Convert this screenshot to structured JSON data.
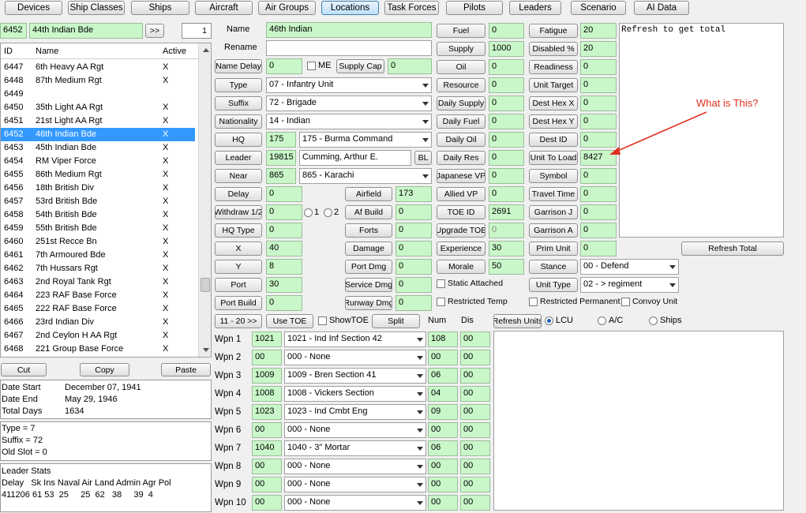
{
  "tabs": [
    "Devices",
    "Ship Classes",
    "Ships",
    "Aircraft",
    "Air Groups",
    "Locations",
    "Task Forces",
    "Pilots",
    "Leaders",
    "Scenario",
    "AI Data"
  ],
  "active_tab": "Locations",
  "nav": {
    "id": "6452",
    "name": "44th Indian Bde",
    "next": ">>",
    "page": "1"
  },
  "list": {
    "headers": {
      "id": "ID",
      "name": "Name",
      "active": "Active"
    },
    "rows": [
      {
        "id": "6447",
        "name": "6th Heavy AA Rgt",
        "active": "X"
      },
      {
        "id": "6448",
        "name": "87th Medium Rgt",
        "active": "X"
      },
      {
        "id": "6449",
        "name": "",
        "active": ""
      },
      {
        "id": "6450",
        "name": "35th Light AA Rgt",
        "active": "X"
      },
      {
        "id": "6451",
        "name": "21st Light AA Rgt",
        "active": "X"
      },
      {
        "id": "6452",
        "name": "46th Indian Bde",
        "active": "X"
      },
      {
        "id": "6453",
        "name": "45th Indian Bde",
        "active": "X"
      },
      {
        "id": "6454",
        "name": "RM Viper Force",
        "active": "X"
      },
      {
        "id": "6455",
        "name": "86th Medium Rgt",
        "active": "X"
      },
      {
        "id": "6456",
        "name": "18th British Div",
        "active": "X"
      },
      {
        "id": "6457",
        "name": "53rd British Bde",
        "active": "X"
      },
      {
        "id": "6458",
        "name": "54th British Bde",
        "active": "X"
      },
      {
        "id": "6459",
        "name": "55th British Bde",
        "active": "X"
      },
      {
        "id": "6460",
        "name": "251st Recce Bn",
        "active": "X"
      },
      {
        "id": "6461",
        "name": "7th Armoured Bde",
        "active": "X"
      },
      {
        "id": "6462",
        "name": "7th Hussars Rgt",
        "active": "X"
      },
      {
        "id": "6463",
        "name": "2nd Royal Tank Rgt",
        "active": "X"
      },
      {
        "id": "6464",
        "name": "223 RAF Base Force",
        "active": "X"
      },
      {
        "id": "6465",
        "name": "222 RAF Base Force",
        "active": "X"
      },
      {
        "id": "6466",
        "name": "23rd Indian Div",
        "active": "X"
      },
      {
        "id": "6467",
        "name": "2nd Ceylon H AA Rgt",
        "active": "X"
      },
      {
        "id": "6468",
        "name": "221 Group Base Force",
        "active": "X"
      }
    ]
  },
  "clip": {
    "cut": "Cut",
    "copy": "Copy",
    "paste": "Paste"
  },
  "dates": {
    "start_label": "Date Start",
    "start": "December 07, 1941",
    "end_label": "Date End",
    "end": "May 29, 1946",
    "total_label": "Total Days",
    "total": "1634"
  },
  "info": {
    "type": "Type = 7",
    "suffix": "Suffix = 72",
    "old_slot": "Old Slot = 0"
  },
  "leader_stats": {
    "title": "Leader Stats",
    "headers": "Delay   Sk Ins Naval Air Land Admin Agr Pol",
    "values": "411206 61 53  25     25  62   38     39  4"
  },
  "form": {
    "name_label": "Name",
    "name": "46th Indian",
    "rename_label": "Rename",
    "rename": "",
    "name_delay_btn": "Name Delay",
    "name_delay": "0",
    "me_label": "ME",
    "supply_cap_btn": "Supply Cap",
    "supply_cap": "0",
    "type_btn": "Type",
    "type": "07 - Infantry Unit",
    "suffix_btn": "Suffix",
    "suffix": "72 - Brigade",
    "nationality_btn": "Nationality",
    "nationality": "14 - Indian",
    "hq_btn": "HQ",
    "hq": "175",
    "hq_sel": "175 - Burma Command",
    "leader_btn": "Leader",
    "leader": "19815",
    "leader_name": "Cumming, Arthur E.",
    "bl": "BL",
    "near_btn": "Near",
    "near": "865",
    "near_sel": "865 - Karachi",
    "delay_btn": "Delay",
    "delay": "0",
    "airfield_btn": "Airfield",
    "airfield": "173",
    "withdraw_btn": "Withdraw 1/2",
    "withdraw": "0",
    "r1": "1",
    "r2": "2",
    "afbuild_btn": "Af Build",
    "afbuild": "0",
    "hqtype_btn": "HQ Type",
    "hqtype": "0",
    "forts_btn": "Forts",
    "forts": "0",
    "x_btn": "X",
    "x": "40",
    "damage_btn": "Damage",
    "damage": "0",
    "y_btn": "Y",
    "y": "8",
    "portdmg_btn": "Port Dmg",
    "portdmg": "0",
    "port_btn": "Port",
    "port": "30",
    "servicedmg_btn": "Service Dmg",
    "servicedmg": "0",
    "portbuild_btn": "Port Build",
    "portbuild": "0",
    "runwaydmg_btn": "Runway Dmg",
    "runwaydmg": "0",
    "next_btn": "11 - 20 >>",
    "usetoe_btn": "Use TOE",
    "showtoe_label": "ShowTOE",
    "split_btn": "Split",
    "num_label": "Num",
    "dis_label": "Dis"
  },
  "stats_mid": [
    {
      "label": "Fuel",
      "value": "0"
    },
    {
      "label": "Supply",
      "value": "1000"
    },
    {
      "label": "Oil",
      "value": "0"
    },
    {
      "label": "Resource",
      "value": "0"
    },
    {
      "label": "Daily Supply",
      "value": "0"
    },
    {
      "label": "Daily Fuel",
      "value": "0"
    },
    {
      "label": "Daily Oil",
      "value": "0"
    },
    {
      "label": "Daily Res",
      "value": "0"
    },
    {
      "label": "Japanese VP",
      "value": "0"
    },
    {
      "label": "Allied VP",
      "value": "0"
    },
    {
      "label": "TOE ID",
      "value": "2691"
    },
    {
      "label": "Upgrade TOE",
      "value": "0"
    },
    {
      "label": "Experience",
      "value": "30"
    },
    {
      "label": "Morale",
      "value": "50"
    }
  ],
  "stats_right": [
    {
      "label": "Fatigue",
      "value": "20"
    },
    {
      "label": "Disabled %",
      "value": "20"
    },
    {
      "label": "Readiness",
      "value": "0"
    },
    {
      "label": "Unit Target",
      "value": "0"
    },
    {
      "label": "Dest Hex X",
      "value": "0"
    },
    {
      "label": "Dest Hex Y",
      "value": "0"
    },
    {
      "label": "Dest ID",
      "value": "0"
    },
    {
      "label": "Unit To Load",
      "value": "8427"
    },
    {
      "label": "Symbol",
      "value": "0"
    },
    {
      "label": "Travel Time",
      "value": "0"
    },
    {
      "label": "Garrison J",
      "value": "0"
    },
    {
      "label": "Garrison A",
      "value": "0"
    },
    {
      "label": "Prim Unit",
      "value": "0"
    }
  ],
  "stance": {
    "label": "Stance",
    "value": "00 - Defend"
  },
  "unit_type": {
    "label": "Unit Type",
    "value": "02 - > regiment"
  },
  "checks": {
    "static_attached": "Static Attached",
    "restricted_temp": "Restricted Temp",
    "restricted_perm": "Restricted Permanent",
    "convoy_unit": "Convoy Unit"
  },
  "refresh": {
    "total_btn": "Refresh Total",
    "total_text": "Refresh to get total",
    "units_btn": "Refresh Units",
    "lcu": "LCU",
    "ac": "A/C",
    "ships": "Ships"
  },
  "annotation": {
    "text": "What is This?",
    "color": "#e0301e"
  },
  "weapons": [
    {
      "label": "Wpn 1",
      "id": "1021",
      "name": "1021 - Ind Inf Section 42",
      "num": "108",
      "dis": "00"
    },
    {
      "label": "Wpn 2",
      "id": "00",
      "name": "000 - None",
      "num": "00",
      "dis": "00"
    },
    {
      "label": "Wpn 3",
      "id": "1009",
      "name": "1009 - Bren Section 41",
      "num": "06",
      "dis": "00"
    },
    {
      "label": "Wpn 4",
      "id": "1008",
      "name": "1008 - Vickers Section",
      "num": "04",
      "dis": "00"
    },
    {
      "label": "Wpn 5",
      "id": "1023",
      "name": "1023 - Ind Cmbt Eng",
      "num": "09",
      "dis": "00"
    },
    {
      "label": "Wpn 6",
      "id": "00",
      "name": "000 - None",
      "num": "00",
      "dis": "00"
    },
    {
      "label": "Wpn 7",
      "id": "1040",
      "name": "1040 - 3\" Mortar",
      "num": "06",
      "dis": "00"
    },
    {
      "label": "Wpn 8",
      "id": "00",
      "name": "000 - None",
      "num": "00",
      "dis": "00"
    },
    {
      "label": "Wpn 9",
      "id": "00",
      "name": "000 - None",
      "num": "00",
      "dis": "00"
    },
    {
      "label": "Wpn 10",
      "id": "00",
      "name": "000 - None",
      "num": "00",
      "dis": "00"
    }
  ]
}
